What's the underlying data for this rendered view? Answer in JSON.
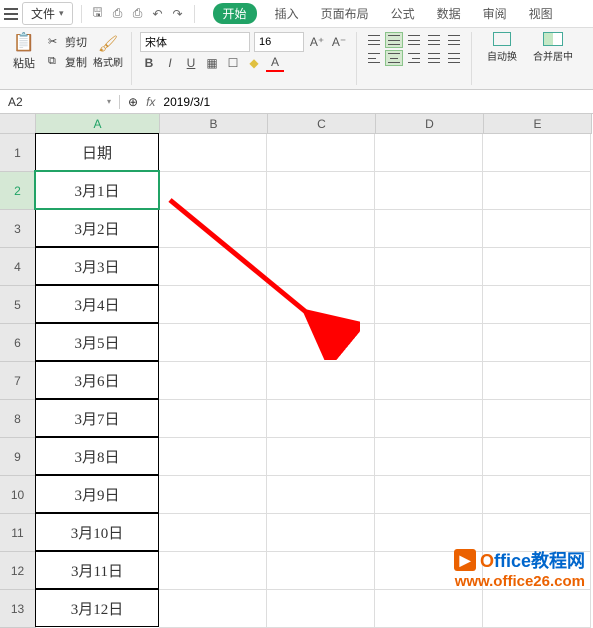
{
  "menubar": {
    "file_label": "文件"
  },
  "tabs": [
    "开始",
    "插入",
    "页面布局",
    "公式",
    "数据",
    "审阅",
    "视图"
  ],
  "ribbon": {
    "paste": "粘贴",
    "cut": "剪切",
    "copy": "复制",
    "format_painter": "格式刷",
    "font_name": "宋体",
    "font_size": "16",
    "wrap": "自动换",
    "merge": "合并居中"
  },
  "namebox": "A2",
  "formula": "2019/3/1",
  "columns": [
    "A",
    "B",
    "C",
    "D",
    "E"
  ],
  "rows": [
    "1",
    "2",
    "3",
    "4",
    "5",
    "6",
    "7",
    "8",
    "9",
    "10",
    "11",
    "12",
    "13"
  ],
  "cells_colA": [
    "日期",
    "3月1日",
    "3月2日",
    "3月3日",
    "3月4日",
    "3月5日",
    "3月6日",
    "3月7日",
    "3月8日",
    "3月9日",
    "3月10日",
    "3月11日",
    "3月12日"
  ],
  "watermark": {
    "title_prefix": "O",
    "title_rest": "ffice教程网",
    "url": "www.office26.com"
  }
}
